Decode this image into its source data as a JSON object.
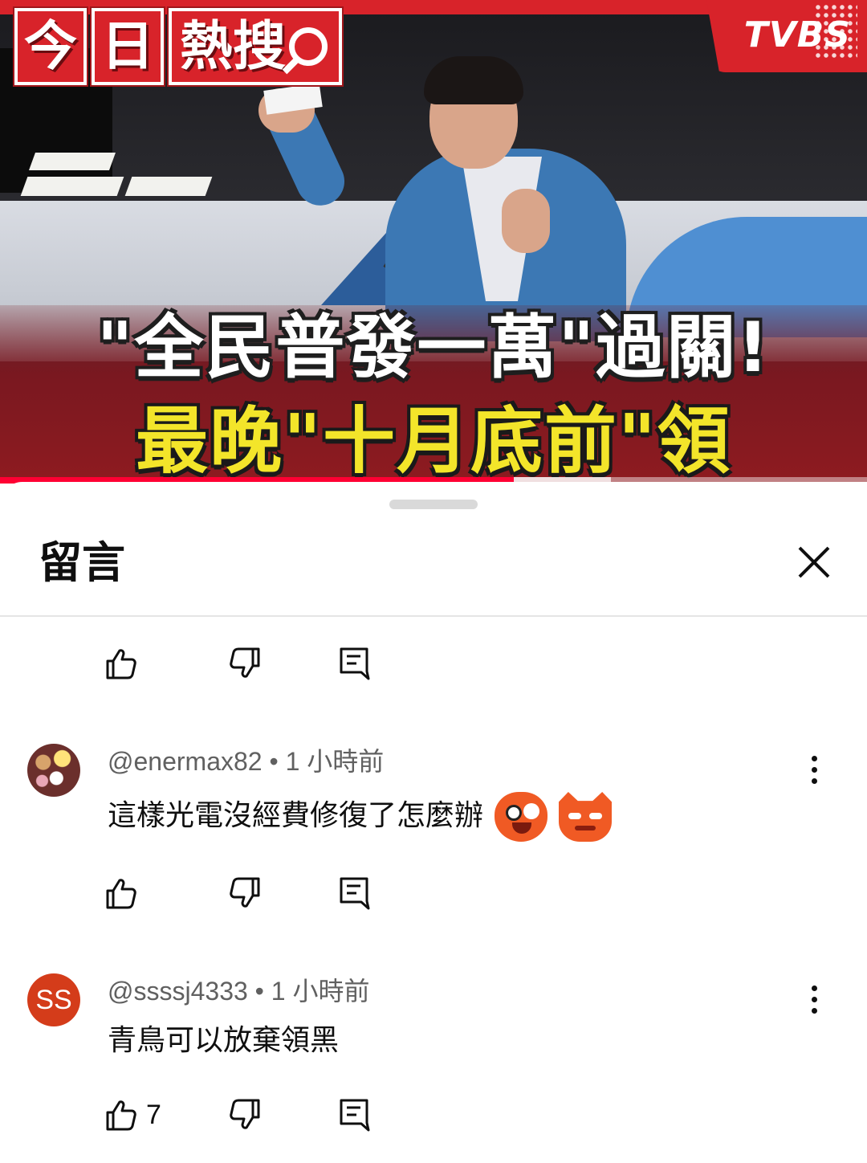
{
  "video": {
    "badge_chars": [
      "今",
      "日",
      "熱搜"
    ],
    "channel_logo": "TVBS",
    "headline_line1": "\"全民普發一萬\"過關!",
    "headline_line2": "最晚\"十月底前\"領",
    "progress_fraction": 0.593,
    "buffered_fraction": 0.705,
    "accent_color": "#ff0033",
    "brand_red": "#d8232a",
    "headline_yellow": "#f3e52a"
  },
  "sheet": {
    "title": "留言",
    "close_icon": "close-icon"
  },
  "top_actions": {
    "like_icon": "thumbs-up-icon",
    "dislike_icon": "thumbs-down-icon",
    "reply_icon": "reply-comment-icon"
  },
  "comments": [
    {
      "author": "@enermax82",
      "separator": "•",
      "time": "1 小時前",
      "text": "這樣光電沒經費修復了怎麼辦",
      "emojis": [
        "surprised-face-emoji",
        "annoyed-cat-emoji"
      ],
      "avatar_color": "#6b2f2c",
      "like_count": ""
    },
    {
      "author": "@ssssj4333",
      "separator": "•",
      "time": "1 小時前",
      "text": "青鳥可以放棄領黑",
      "avatar_initials": "SS",
      "avatar_color": "#d43c1a",
      "like_count": "7"
    }
  ]
}
